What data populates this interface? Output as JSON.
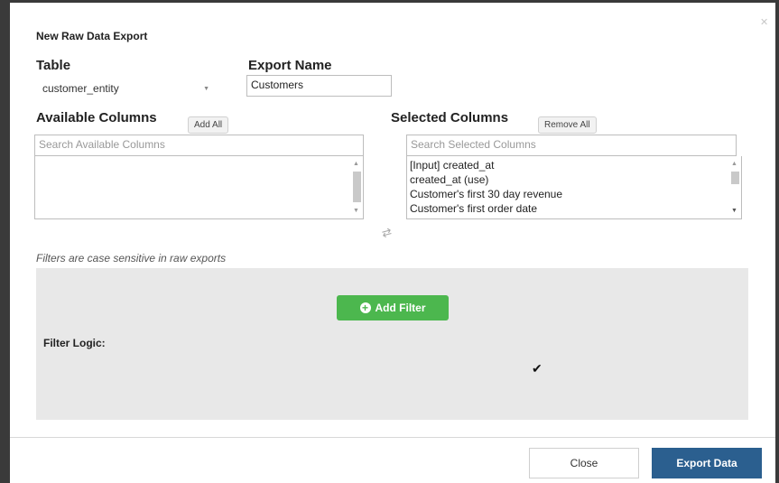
{
  "dialog": {
    "title": "New Raw Data Export",
    "close_icon": "close-icon"
  },
  "table": {
    "label": "Table",
    "selected": "customer_entity"
  },
  "export_name": {
    "label": "Export Name",
    "value": "Customers"
  },
  "available_columns": {
    "label": "Available Columns",
    "add_all_label": "Add All",
    "search_placeholder": "Search Available Columns",
    "items": []
  },
  "selected_columns": {
    "label": "Selected Columns",
    "remove_all_label": "Remove All",
    "search_placeholder": "Search Selected Columns",
    "items": [
      "[Input] created_at",
      "created_at (use)",
      "Customer's first 30 day revenue",
      "Customer's first order date"
    ]
  },
  "filters": {
    "note": "Filters are case sensitive in raw exports",
    "add_filter_label": "Add Filter",
    "filter_logic_label": "Filter Logic:"
  },
  "footer": {
    "close_label": "Close",
    "export_label": "Export Data"
  },
  "colors": {
    "frame": "#3a3a3a",
    "add_filter_green": "#4cb74e",
    "export_blue": "#2b5f8f",
    "filter_panel_bg": "#e8e8e8"
  }
}
